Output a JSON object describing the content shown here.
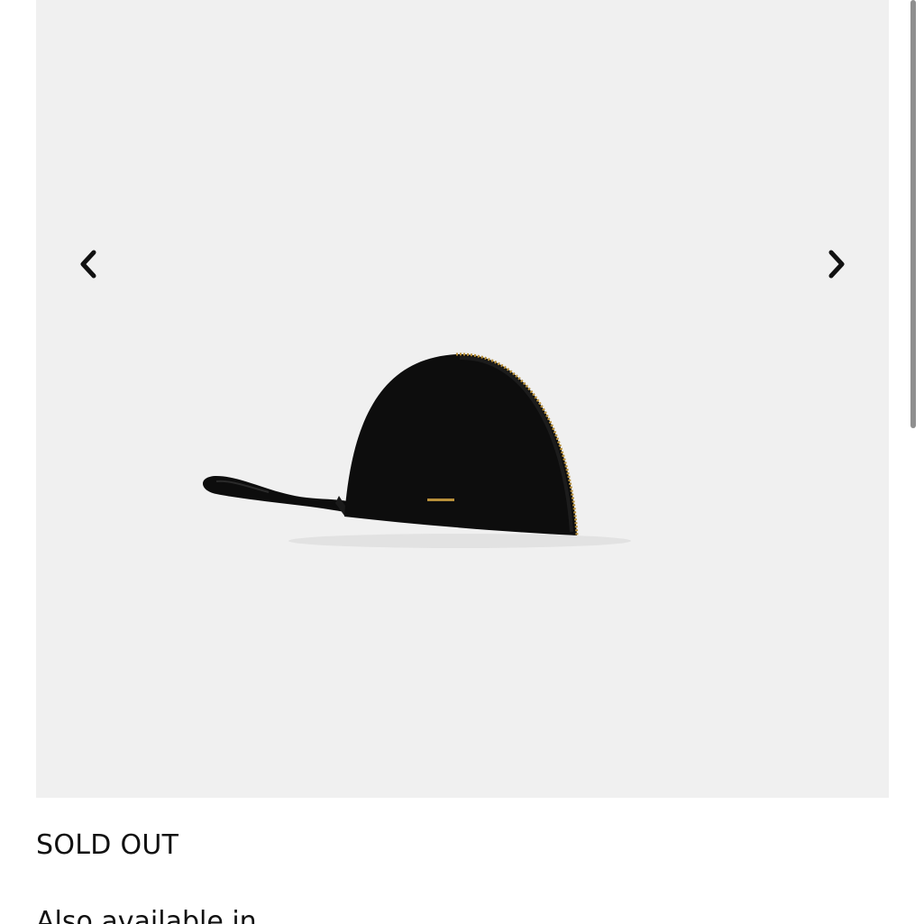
{
  "gallery": {
    "prev_icon": "chevron-left-icon",
    "next_icon": "chevron-right-icon",
    "background_color": "#f0f0f0",
    "product_color": "#0d0d0d",
    "zipper_color": "#b8903a"
  },
  "product": {
    "stock_status": "SOLD OUT",
    "also_available_label": "Also available in"
  },
  "scrollbar": {
    "color": "#8f8f8f"
  }
}
